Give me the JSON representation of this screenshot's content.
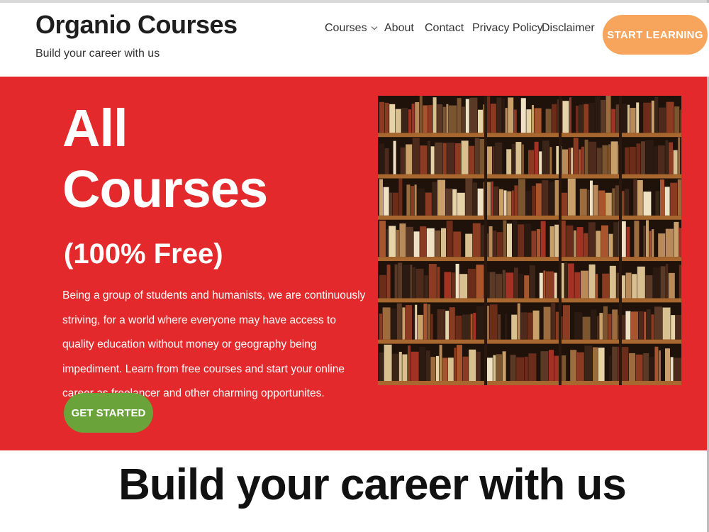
{
  "header": {
    "brand_title": "Organio Courses",
    "brand_tagline": "Build your career with us",
    "nav": {
      "courses": "Courses",
      "about": "About",
      "contact": "Contact",
      "privacy": "Privacy Policy",
      "disclaimer": "Disclaimer"
    },
    "cta_label": "START LEARNING"
  },
  "hero": {
    "title_line1": "All",
    "title_line2": "Courses",
    "subtitle": "(100% Free)",
    "description": "Being a group of students and humanists, we are continuously striving, for a world where everyone may have access to quality education without money or geography being impediment. Learn from free courses and start your online career as freelancer and other charming opportunites.",
    "button_label": "GET STARTED"
  },
  "section": {
    "heading": "Build your career with us"
  },
  "colors": {
    "hero_bg": "#e3292b",
    "cta_orange": "#f7a45c",
    "get_started_green": "#6aa33a"
  }
}
